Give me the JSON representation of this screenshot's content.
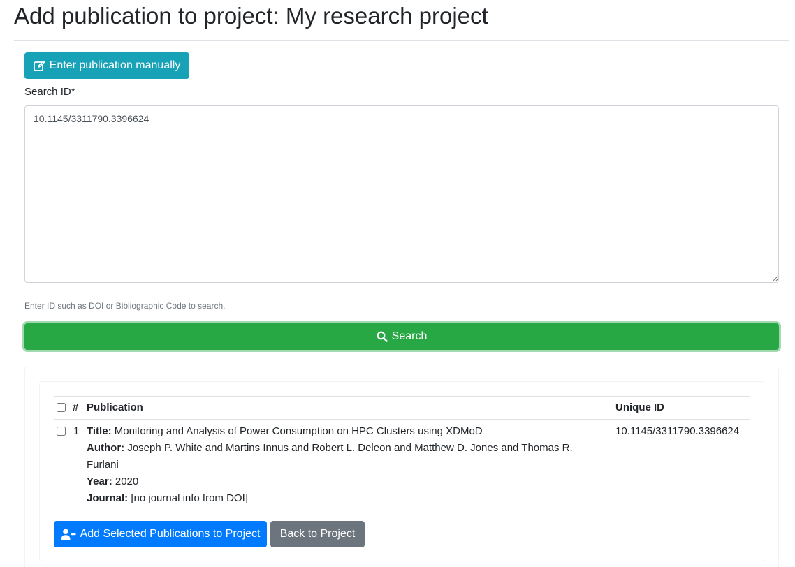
{
  "page": {
    "title": "Add publication to project: My research project"
  },
  "manual_button": {
    "label": "Enter publication manually",
    "icon": "edit-icon"
  },
  "search": {
    "label": "Search ID*",
    "value": "10.1145/3311790.3396624",
    "help_text": "Enter ID such as DOI or Bibliographic Code to search.",
    "button_label": "Search",
    "button_icon": "search-icon"
  },
  "results_table": {
    "headers": {
      "number": "#",
      "publication": "Publication",
      "unique_id": "Unique ID"
    },
    "rows": [
      {
        "number": "1",
        "title_label": "Title:",
        "title": "Monitoring and Analysis of Power Consumption on HPC Clusters using XDMoD",
        "author_label": "Author:",
        "author_line1": "Joseph P. White and Martins Innus and Robert L. Deleon and Matthew D. Jones and Thomas R.",
        "author_line2": "Furlani",
        "year_label": "Year:",
        "year": "2020",
        "journal_label": "Journal:",
        "journal": "[no journal info from DOI]",
        "unique_id": "10.1145/3311790.3396624",
        "selected": false
      }
    ]
  },
  "actions": {
    "add_label": "Add Selected Publications to Project",
    "add_icon": "user-minus-icon",
    "back_label": "Back to Project"
  },
  "colors": {
    "info": "#17a2b8",
    "success": "#28a745",
    "primary": "#007bff",
    "secondary": "#6c757d"
  }
}
